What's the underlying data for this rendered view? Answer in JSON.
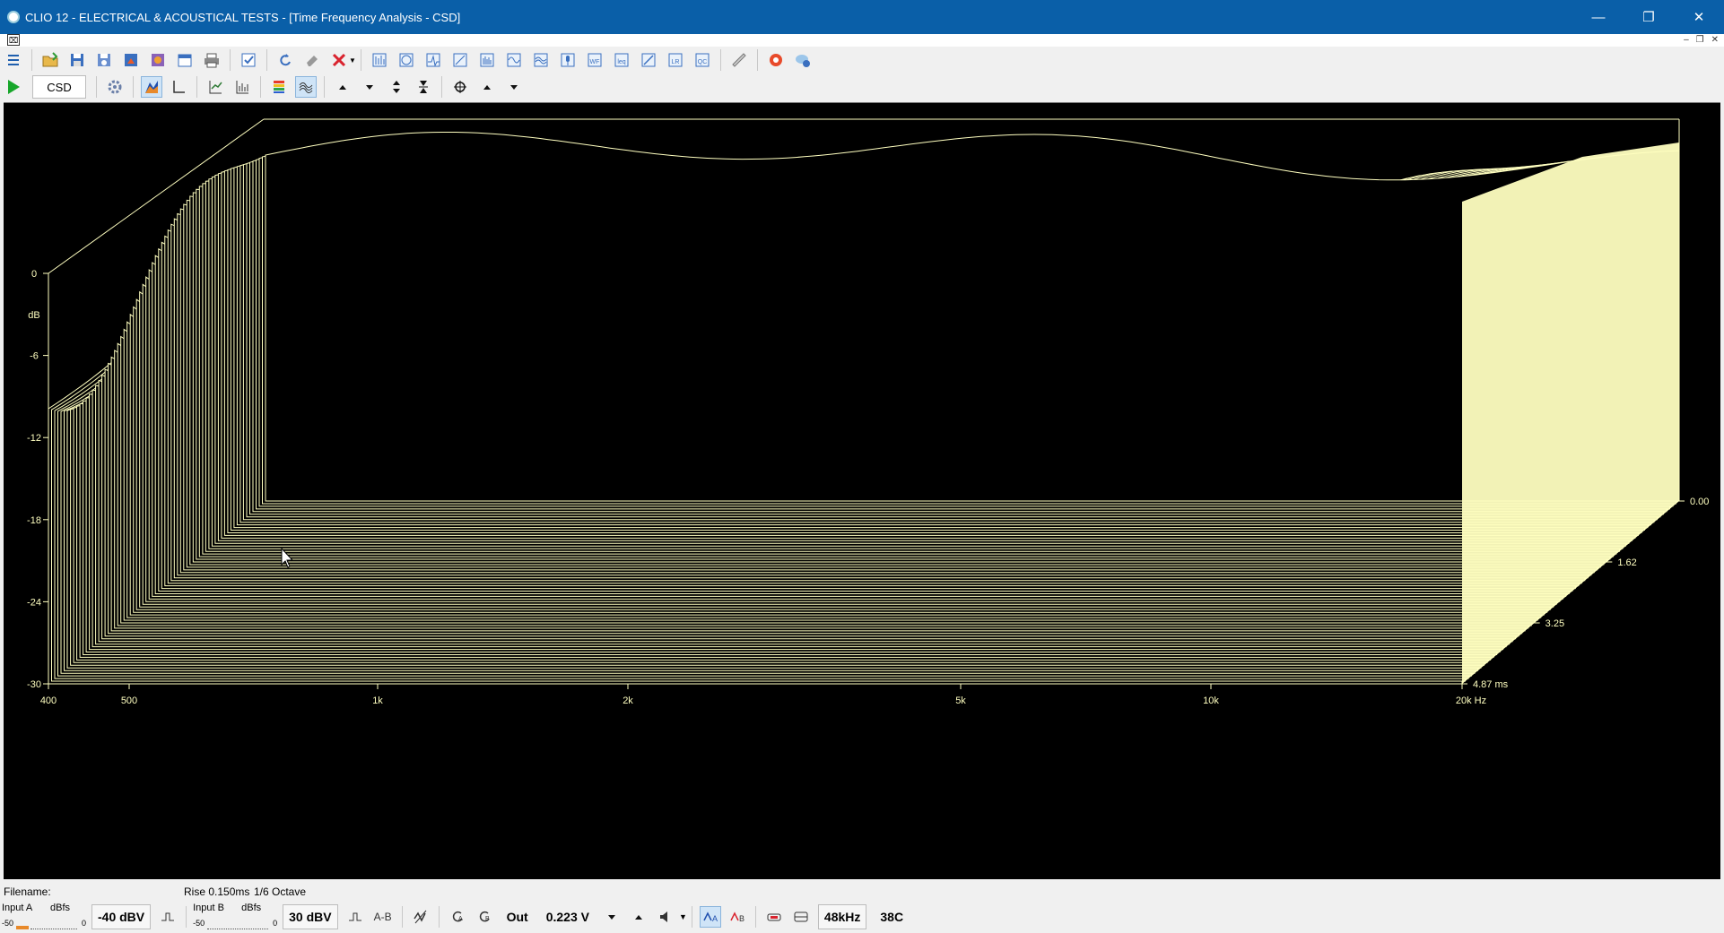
{
  "window": {
    "title": "CLIO 12 - ELECTRICAL & ACOUSTICAL TESTS - [Time Frequency Analysis - CSD]",
    "minimize": "—",
    "restore": "❐",
    "close": "✕"
  },
  "mdi": {
    "icon": "⌧",
    "minimize": "–",
    "restore": "❐",
    "close": "✕"
  },
  "toolbar2": {
    "mode_label": "CSD"
  },
  "plot": {
    "background": "#000000",
    "surface_color": "#ffffc0",
    "y_axis": {
      "unit": "dB",
      "ticks": [
        "0",
        "-6",
        "-12",
        "-18",
        "-24",
        "-30"
      ]
    },
    "x_axis": {
      "ticks": [
        "400",
        "500",
        "1k",
        "2k",
        "5k",
        "10k",
        "20k Hz"
      ]
    },
    "t_axis": {
      "ticks": [
        "0.00",
        "1.62",
        "3.25",
        "4.87 ms"
      ]
    }
  },
  "status": {
    "filename_label": "Filename:",
    "rise": "Rise 0.150ms",
    "octave": "1/6 Octave"
  },
  "bottom": {
    "input_a": {
      "label": "Input A",
      "unit": "dBfs",
      "min": "-50",
      "max": "0",
      "value": "-40 dBV"
    },
    "input_b": {
      "label": "Input B",
      "unit": "dBfs",
      "min": "-50",
      "max": "0",
      "value": "30 dBV"
    },
    "ab_label": "A-B",
    "out_label": "Out",
    "out_value": "0.223 V",
    "sample_rate": "48kHz",
    "temperature": "38C"
  }
}
